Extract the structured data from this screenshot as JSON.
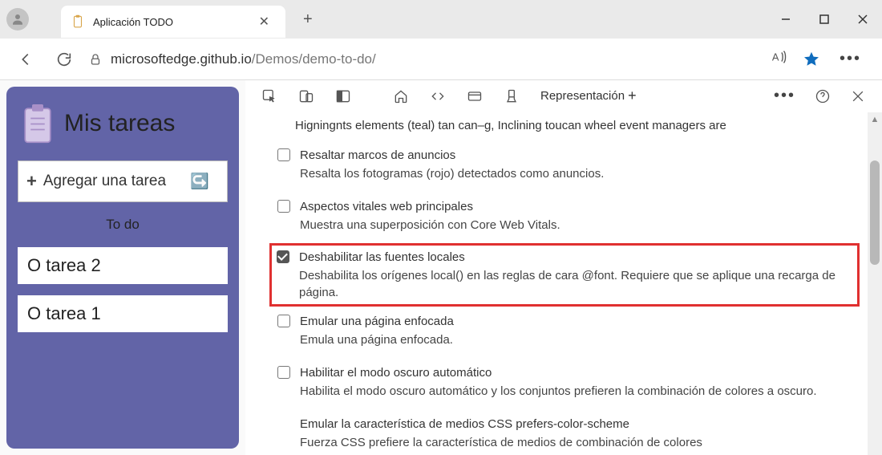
{
  "browser": {
    "tab_title": "Aplicación TODO",
    "url_domain": "microsoftedge.github.io",
    "url_path": "/Demos/demo-to-do/"
  },
  "app": {
    "title": "Mis tareas",
    "add_task_label": "Agregar una tarea",
    "section_label": "To do",
    "tasks": [
      "O tarea 2",
      "O tarea 1"
    ]
  },
  "devtools": {
    "tab_label": "Representación",
    "intro_line": "Higningnts elements (teal) tan can–g, Inclining toucan wheel event managers are",
    "options": [
      {
        "title": "Resaltar marcos de anuncios",
        "desc": "Resalta los fotogramas (rojo) detectados como anuncios.",
        "checked": false,
        "highlighted": false
      },
      {
        "title": "Aspectos vitales web principales",
        "desc": "Muestra una superposición con Core Web Vitals.",
        "checked": false,
        "highlighted": false
      },
      {
        "title": "Deshabilitar las fuentes locales",
        "desc": "Deshabilita los orígenes local() en las reglas de cara @font. Requiere que se aplique una recarga de página.",
        "checked": true,
        "highlighted": true
      },
      {
        "title": "Emular una página enfocada",
        "desc": "Emula una página enfocada.",
        "checked": false,
        "highlighted": false
      },
      {
        "title": "Habilitar el modo oscuro automático",
        "desc": "Habilita el modo oscuro automático y los conjuntos prefieren la combinación de colores a oscuro.",
        "checked": false,
        "highlighted": false
      }
    ],
    "no_checkbox_option": {
      "title": "Emular la característica de medios CSS prefers-color-scheme",
      "desc": "Fuerza CSS prefiere la característica de medios de combinación de colores"
    }
  }
}
